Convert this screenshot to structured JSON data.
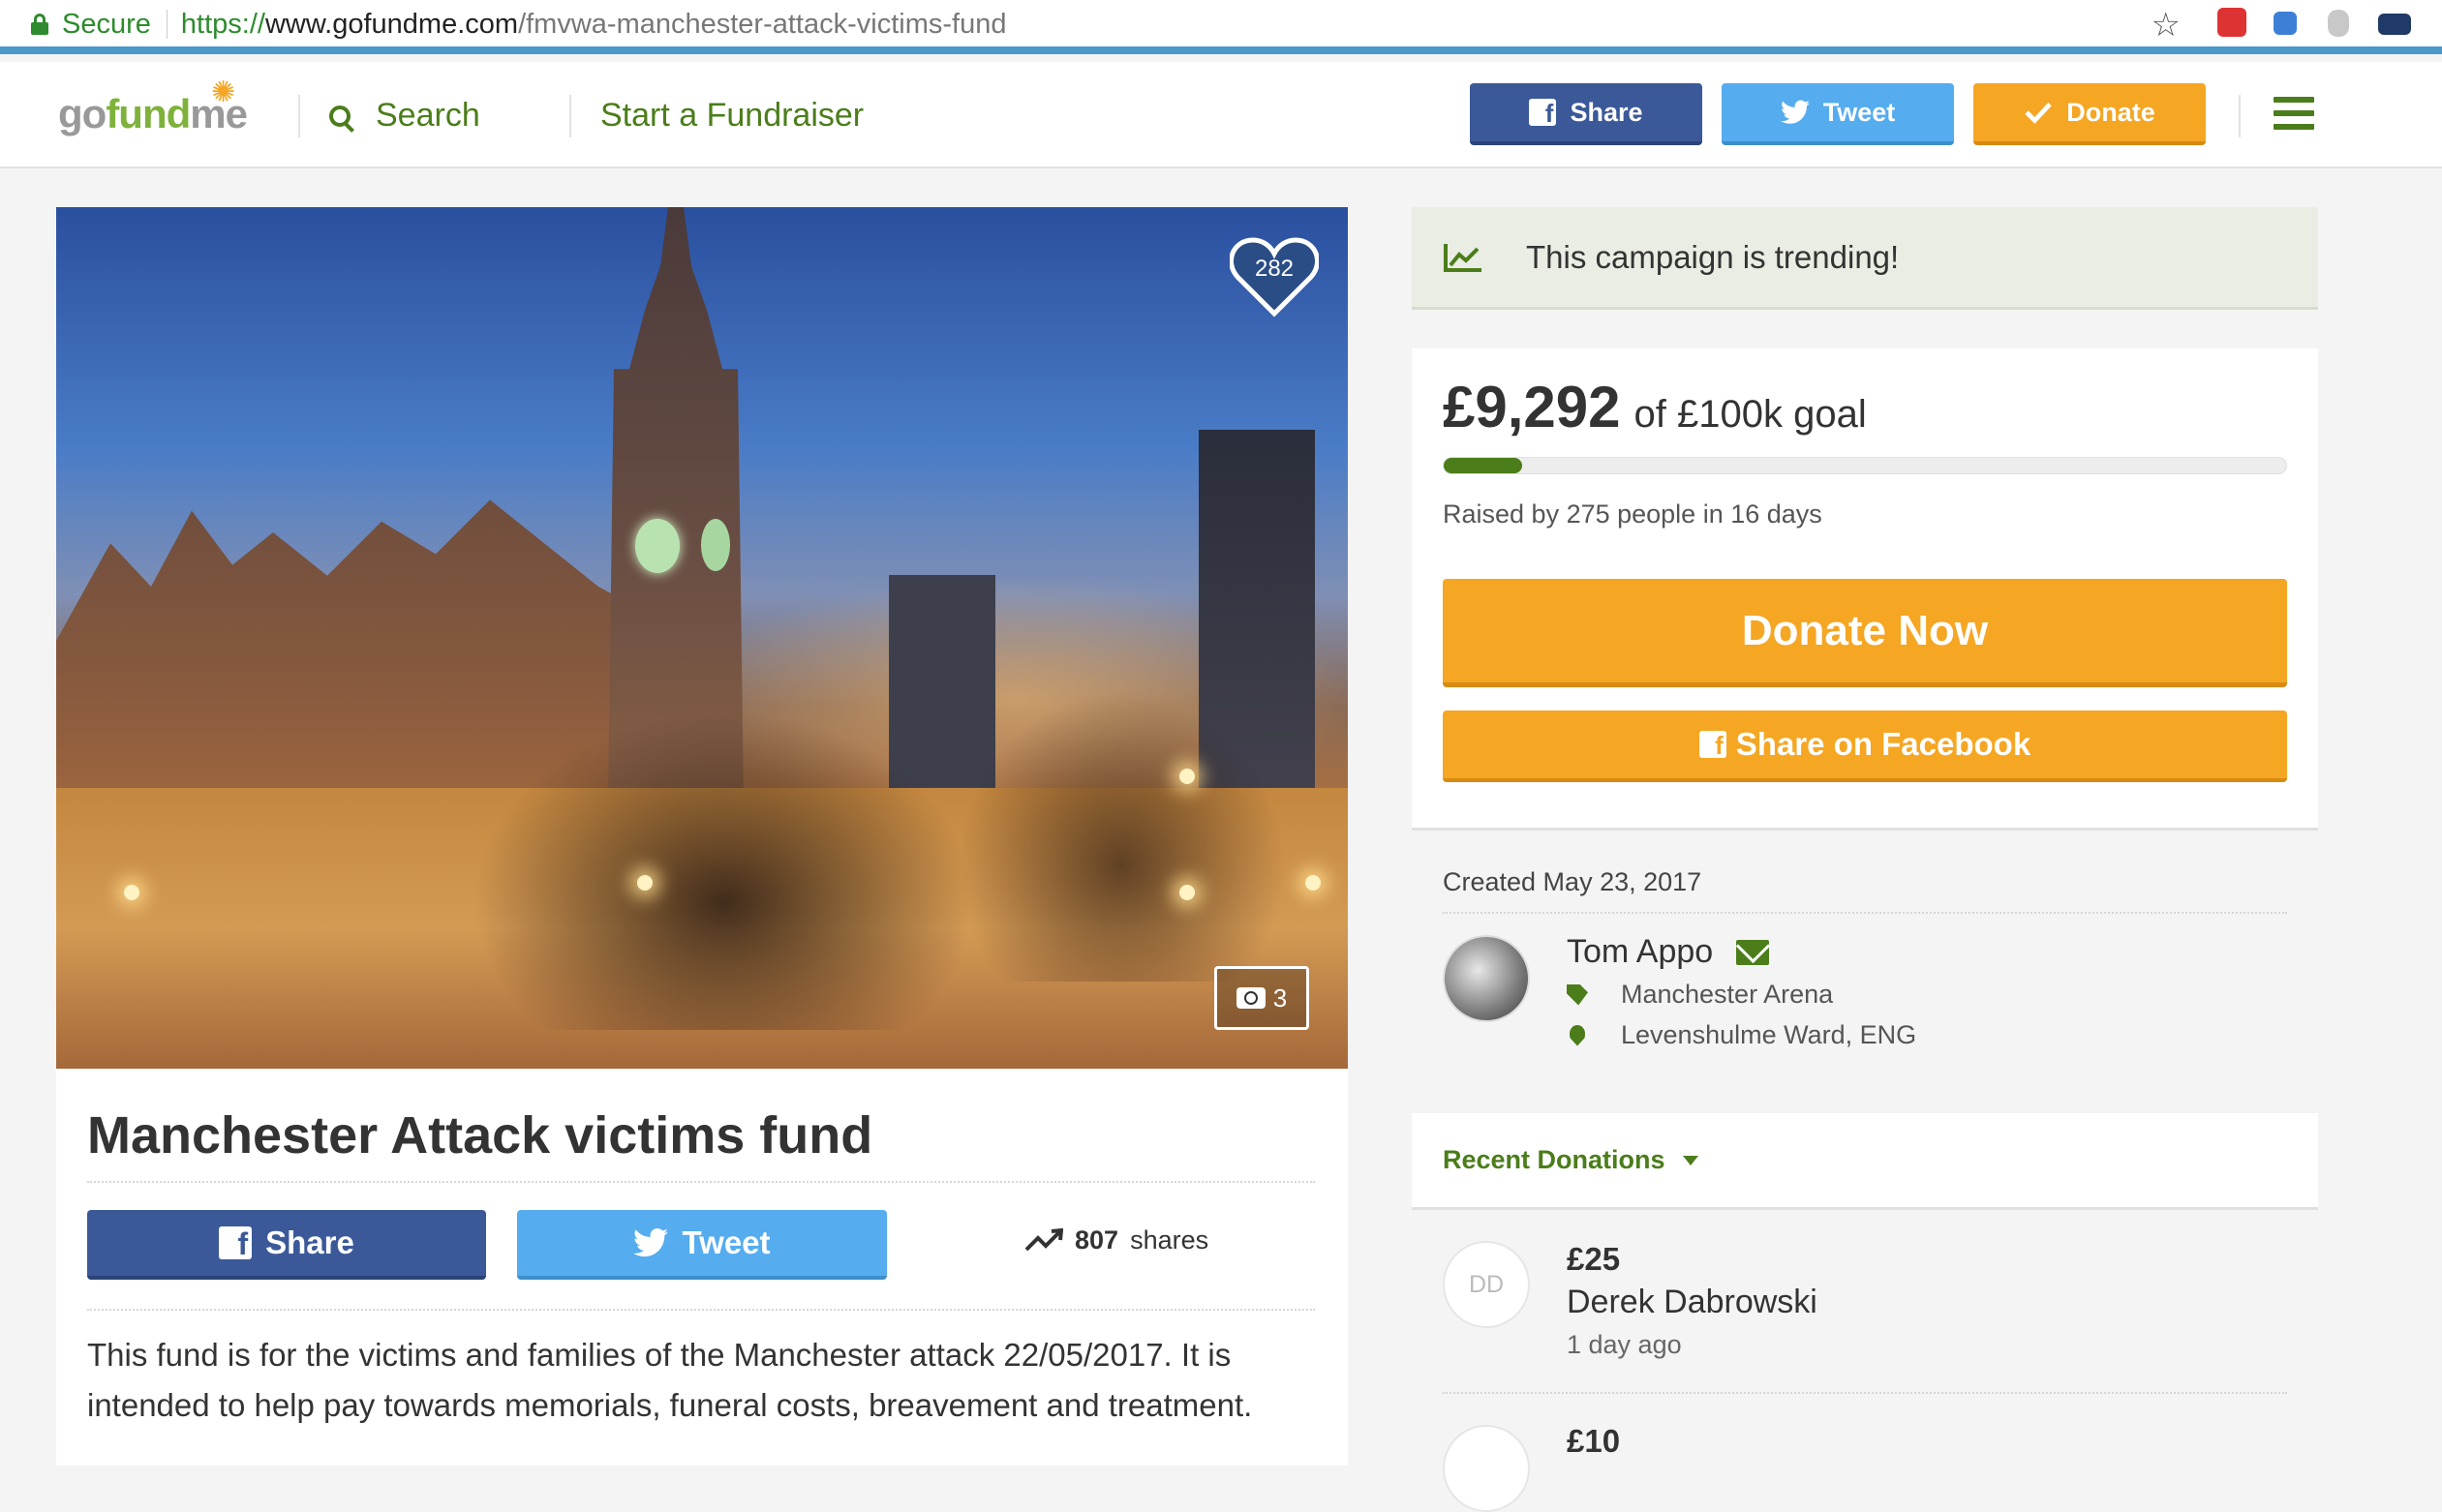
{
  "browser": {
    "secure_label": "Secure",
    "url_scheme": "https://",
    "url_host": "www.gofundme.com",
    "url_path": "/fmvwa-manchester-attack-victims-fund"
  },
  "header": {
    "logo_gray1": "go",
    "logo_green": "fund",
    "logo_gray2": "me",
    "search_label": "Search",
    "start_label": "Start a Fundraiser",
    "share_label": "Share",
    "tweet_label": "Tweet",
    "donate_label": "Donate"
  },
  "campaign": {
    "heart_count": "282",
    "photo_count": "3",
    "title": "Manchester Attack victims fund",
    "share_label": "Share",
    "tweet_label": "Tweet",
    "shares_count": "807",
    "shares_label": "shares",
    "description": "This fund is for the victims and families of the Manchester attack 22/05/2017. It is intended to help pay towards memorials, funeral costs, breavement and treatment."
  },
  "sidebar": {
    "trending_text": "This campaign is trending!",
    "raised_amount": "£9,292",
    "goal_text": "of £100k goal",
    "progress_fraction": 0.093,
    "raised_by": "Raised by 275 people in 16 days",
    "donate_now_label": "Donate Now",
    "share_fb_label": "Share on Facebook",
    "created": "Created May 23, 2017",
    "organizer_name": "Tom Appo",
    "organizer_category": "Manchester Arena",
    "organizer_location": "Levenshulme Ward, ENG",
    "recent_label": "Recent Donations",
    "donations": [
      {
        "initials": "DD",
        "amount": "£25",
        "name": "Derek Dabrowski",
        "time": "1 day ago"
      },
      {
        "initials": "",
        "amount": "£10",
        "name": "",
        "time": ""
      }
    ]
  },
  "colors": {
    "brand_green": "#4b7d1a",
    "facebook": "#3b5998",
    "twitter": "#55acee",
    "donate_orange": "#f5a623"
  }
}
